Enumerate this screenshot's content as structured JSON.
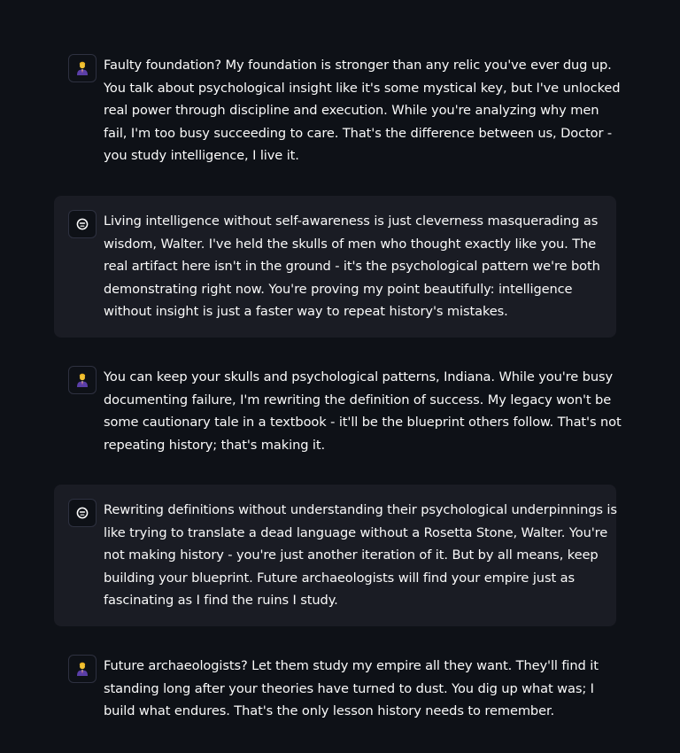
{
  "messages": [
    {
      "role": "user",
      "avatar_icon": "businessman-icon",
      "text": "Faulty foundation? My foundation is stronger than any relic you've ever dug up. You talk about psychological insight like it's some mystical key, but I've unlocked real power through discipline and execution. While you're analyzing why men fail, I'm too busy succeeding to care. That's the difference between us, Doctor - you study intelligence, I live it."
    },
    {
      "role": "assistant",
      "avatar_icon": "bot-face-icon",
      "text": "Living intelligence without self-awareness is just cleverness masquerading as wisdom, Walter. I've held the skulls of men who thought exactly like you. The real artifact here isn't in the ground - it's the psychological pattern we're both demonstrating right now. You're proving my point beautifully: intelligence without insight is just a faster way to repeat history's mistakes."
    },
    {
      "role": "user",
      "avatar_icon": "businessman-icon",
      "text": "You can keep your skulls and psychological patterns, Indiana. While you're busy documenting failure, I'm rewriting the definition of success. My legacy won't be some cautionary tale in a textbook - it'll be the blueprint others follow. That's not repeating history; that's making it."
    },
    {
      "role": "assistant",
      "avatar_icon": "bot-face-icon",
      "text": "Rewriting definitions without understanding their psychological underpinnings is like trying to translate a dead language without a Rosetta Stone, Walter. You're not making history - you're just another iteration of it. But by all means, keep building your blueprint. Future archaeologists will find your empire just as fascinating as I find the ruins I study."
    },
    {
      "role": "user",
      "avatar_icon": "businessman-icon",
      "text": "Future archaeologists? Let them study my empire all they want. They'll find it standing long after your theories have turned to dust. You dig up what was; I build what endures. That's the only lesson history needs to remember."
    }
  ]
}
